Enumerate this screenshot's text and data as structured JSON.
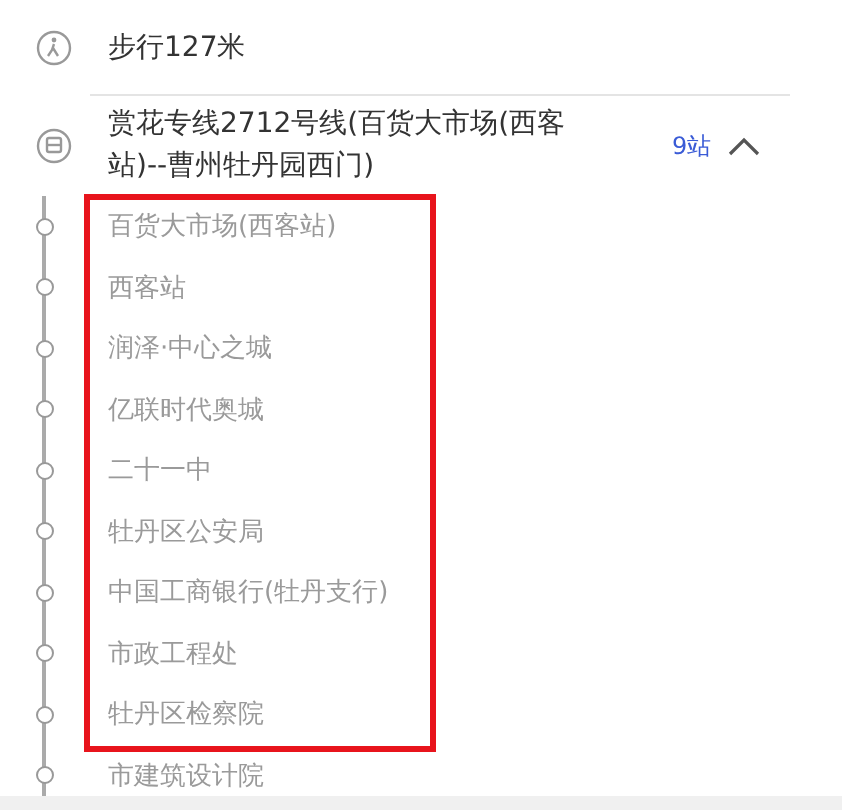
{
  "walk": {
    "text": "步行127米"
  },
  "bus": {
    "title": "赏花专线2712号线(百货大市场(西客站)--曹州牡丹园西门)",
    "stop_count": "9站",
    "expanded": true
  },
  "stops": [
    {
      "name": "百货大市场(西客站)",
      "highlighted": true
    },
    {
      "name": "西客站",
      "highlighted": true
    },
    {
      "name": "润泽·中心之城",
      "highlighted": true
    },
    {
      "name": "亿联时代奥城",
      "highlighted": true
    },
    {
      "name": "二十一中",
      "highlighted": true
    },
    {
      "name": "牡丹区公安局",
      "highlighted": true
    },
    {
      "name": "中国工商银行(牡丹支行)",
      "highlighted": true
    },
    {
      "name": "市政工程处",
      "highlighted": true
    },
    {
      "name": "牡丹区检察院",
      "highlighted": true
    },
    {
      "name": "市建筑设计院",
      "highlighted": false
    }
  ]
}
